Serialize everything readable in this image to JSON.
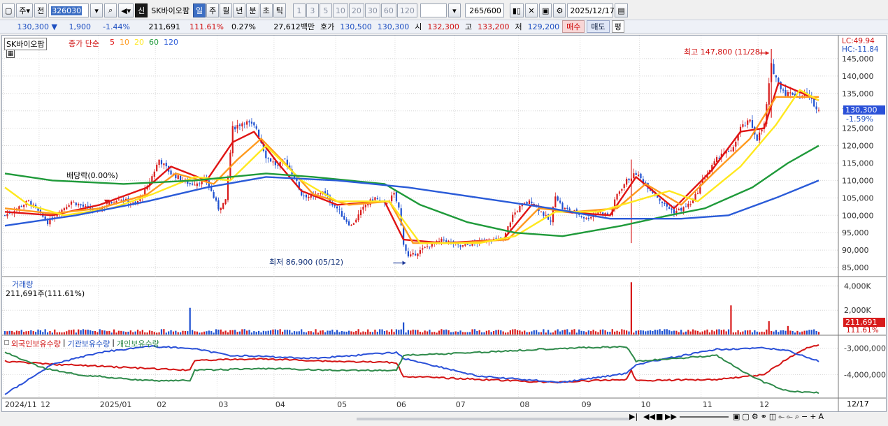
{
  "toolbar": {
    "period_label": "주",
    "prev_label": "전",
    "code": "326030",
    "shin_label": "신",
    "stock_name": "SK바이오팜",
    "period_buttons": [
      "일",
      "주",
      "월",
      "년",
      "분",
      "초",
      "틱"
    ],
    "period_selected": "일",
    "intervals": [
      "1",
      "3",
      "5",
      "10",
      "20",
      "30",
      "60",
      "120"
    ],
    "count_value": "265",
    "count_total": "/600",
    "date_value": "2025/12/17"
  },
  "quote": {
    "price": "130,300",
    "change": "1,900",
    "change_pct": "-1.44%",
    "volume": "211,691",
    "volume_ratio": "111.61%",
    "turnover_rate": "0.27%",
    "amount": "27,612백만",
    "bid_label": "호가",
    "bid": "130,500",
    "ask": "130,300",
    "open_label": "시",
    "open": "132,300",
    "high_label": "고",
    "high": "133,200",
    "low_label": "저",
    "low": "129,200",
    "buy_label": "매수",
    "sell_label": "매도",
    "avg_label": "평"
  },
  "price_panel": {
    "stock_label": "SK바이오팜",
    "legend_prefix": "종가 단순",
    "ma_periods": [
      "5",
      "10",
      "20",
      "60",
      "120"
    ],
    "ma_colors": [
      "#e01414",
      "#ff9a1e",
      "#ffe81e",
      "#1f9a3a",
      "#2a5bd8"
    ],
    "lc_label": "LC:49.94",
    "hc_label": "HC:-11.84",
    "current_price_tag": "130,300",
    "current_pct_tag": "-1.59%",
    "high_annotation": "최고 147,800 (11/28)",
    "low_annotation": "최저 86,900 (05/12)",
    "dividend_annotation": "배당락(0.00%)"
  },
  "volume_panel": {
    "title": "거래량",
    "value_label": "211,691주(111.61%)",
    "current_tag": "211,691",
    "current_pct": "111.61%"
  },
  "holdings_panel": {
    "foreign_label": "외국인보유수량",
    "institution_label": "기관보유수량",
    "individual_label": "개인보유수량",
    "sep1": "|",
    "sep2": "|"
  },
  "x_axis": {
    "labels": [
      "2024/11",
      "12",
      "2025/01",
      "02",
      "03",
      "04",
      "05",
      "06",
      "07",
      "08",
      "09",
      "10",
      "11",
      "12"
    ],
    "right_label": "12/17"
  },
  "chart_data": [
    {
      "type": "candlestick",
      "title": "SK바이오팜",
      "ylim": [
        83000,
        150000
      ],
      "y_ticks": [
        85000,
        90000,
        95000,
        100000,
        105000,
        110000,
        115000,
        120000,
        125000,
        130000,
        135000,
        140000,
        145000
      ],
      "y_tick_labels": [
        "85,000",
        "90,000",
        "95,000",
        "100,000",
        "105,000",
        "110,000",
        "115,000",
        "120,000",
        "125,000",
        "130,000",
        "135,000",
        "140,000",
        "145,000"
      ],
      "up_color": "#d81b1b",
      "down_color": "#1e50d0",
      "close_path": [
        [
          0,
          100000
        ],
        [
          10,
          104000
        ],
        [
          18,
          98000
        ],
        [
          28,
          104000
        ],
        [
          38,
          101000
        ],
        [
          48,
          105000
        ],
        [
          55,
          103000
        ],
        [
          60,
          108000
        ],
        [
          65,
          116000
        ],
        [
          70,
          112000
        ],
        [
          78,
          109000
        ],
        [
          85,
          110000
        ],
        [
          90,
          102000
        ],
        [
          93,
          104000
        ],
        [
          96,
          125000
        ],
        [
          101,
          127000
        ],
        [
          106,
          125000
        ],
        [
          110,
          117000
        ],
        [
          115,
          114000
        ],
        [
          118,
          116000
        ],
        [
          122,
          111000
        ],
        [
          125,
          106000
        ],
        [
          130,
          105000
        ],
        [
          134,
          107000
        ],
        [
          137,
          104000
        ],
        [
          140,
          102000
        ],
        [
          143,
          99000
        ],
        [
          146,
          97000
        ],
        [
          149,
          100000
        ],
        [
          152,
          103000
        ],
        [
          156,
          105000
        ],
        [
          160,
          103000
        ],
        [
          164,
          106000
        ],
        [
          166,
          102000
        ],
        [
          168,
          92000
        ],
        [
          170,
          88000
        ],
        [
          173,
          89000
        ],
        [
          178,
          91000
        ],
        [
          185,
          93000
        ],
        [
          192,
          91000
        ],
        [
          198,
          92000
        ],
        [
          204,
          93000
        ],
        [
          210,
          93000
        ],
        [
          214,
          100000
        ],
        [
          218,
          103000
        ],
        [
          222,
          104000
        ],
        [
          226,
          101000
        ],
        [
          230,
          98000
        ],
        [
          232,
          106000
        ],
        [
          235,
          102000
        ],
        [
          240,
          101000
        ],
        [
          245,
          99000
        ],
        [
          250,
          101000
        ],
        [
          255,
          100000
        ],
        [
          258,
          106000
        ],
        [
          262,
          110000
        ],
        [
          266,
          112000
        ],
        [
          270,
          109000
        ],
        [
          274,
          106000
        ],
        [
          278,
          103000
        ],
        [
          282,
          101000
        ],
        [
          286,
          102000
        ],
        [
          290,
          104000
        ],
        [
          294,
          110000
        ],
        [
          298,
          114000
        ],
        [
          302,
          118000
        ],
        [
          306,
          118000
        ],
        [
          310,
          125000
        ],
        [
          314,
          127000
        ],
        [
          317,
          122000
        ],
        [
          320,
          126000
        ],
        [
          323,
          143000
        ],
        [
          326,
          138000
        ],
        [
          329,
          135000
        ],
        [
          332,
          135000
        ],
        [
          335,
          134000
        ],
        [
          338,
          135000
        ],
        [
          341,
          132000
        ],
        [
          343,
          130300
        ]
      ],
      "ma": [
        {
          "period": 5,
          "points": [
            [
              0,
              101000
            ],
            [
              20,
              100000
            ],
            [
              40,
              103000
            ],
            [
              60,
              108000
            ],
            [
              70,
              114000
            ],
            [
              85,
              110000
            ],
            [
              96,
              121000
            ],
            [
              105,
              124000
            ],
            [
              115,
              115000
            ],
            [
              125,
              107000
            ],
            [
              140,
              103000
            ],
            [
              160,
              104000
            ],
            [
              168,
              93000
            ],
            [
              185,
              92000
            ],
            [
              210,
              93000
            ],
            [
              222,
              103000
            ],
            [
              235,
              101000
            ],
            [
              255,
              100000
            ],
            [
              266,
              111000
            ],
            [
              282,
              102000
            ],
            [
              298,
              113000
            ],
            [
              310,
              124000
            ],
            [
              320,
              125000
            ],
            [
              326,
              138000
            ],
            [
              343,
              133000
            ]
          ]
        },
        {
          "period": 10,
          "points": [
            [
              0,
              102000
            ],
            [
              20,
              100500
            ],
            [
              40,
              102000
            ],
            [
              60,
              106000
            ],
            [
              72,
              112000
            ],
            [
              88,
              109000
            ],
            [
              98,
              116000
            ],
            [
              108,
              122000
            ],
            [
              118,
              115000
            ],
            [
              130,
              106000
            ],
            [
              145,
              103000
            ],
            [
              162,
              104000
            ],
            [
              172,
              92000
            ],
            [
              190,
              92000
            ],
            [
              212,
              93000
            ],
            [
              225,
              102000
            ],
            [
              240,
              101000
            ],
            [
              258,
              102000
            ],
            [
              270,
              109000
            ],
            [
              285,
              103000
            ],
            [
              300,
              113000
            ],
            [
              314,
              122000
            ],
            [
              325,
              134000
            ],
            [
              343,
              134000
            ]
          ]
        },
        {
          "period": 20,
          "points": [
            [
              0,
              108000
            ],
            [
              10,
              103000
            ],
            [
              25,
              100000
            ],
            [
              45,
              102000
            ],
            [
              62,
              106000
            ],
            [
              80,
              111000
            ],
            [
              95,
              110000
            ],
            [
              110,
              120000
            ],
            [
              125,
              110000
            ],
            [
              140,
              104000
            ],
            [
              162,
              104000
            ],
            [
              175,
              92000
            ],
            [
              200,
              92000
            ],
            [
              215,
              94000
            ],
            [
              232,
              101000
            ],
            [
              250,
              101000
            ],
            [
              265,
              104000
            ],
            [
              280,
              107000
            ],
            [
              292,
              104000
            ],
            [
              310,
              114000
            ],
            [
              325,
              126000
            ],
            [
              335,
              136000
            ],
            [
              343,
              133000
            ]
          ]
        },
        {
          "period": 60,
          "points": [
            [
              0,
              112000
            ],
            [
              20,
              110000
            ],
            [
              50,
              109000
            ],
            [
              80,
              110000
            ],
            [
              110,
              112000
            ],
            [
              130,
              111000
            ],
            [
              160,
              109000
            ],
            [
              175,
              103000
            ],
            [
              195,
              98000
            ],
            [
              215,
              95000
            ],
            [
              235,
              94000
            ],
            [
              260,
              97000
            ],
            [
              280,
              100000
            ],
            [
              295,
              102000
            ],
            [
              315,
              108000
            ],
            [
              330,
              115000
            ],
            [
              343,
              120000
            ]
          ]
        },
        {
          "period": 120,
          "points": [
            [
              0,
              97000
            ],
            [
              30,
              100000
            ],
            [
              60,
              104000
            ],
            [
              85,
              108000
            ],
            [
              110,
              111000
            ],
            [
              140,
              110000
            ],
            [
              170,
              108000
            ],
            [
              200,
              105000
            ],
            [
              230,
              102000
            ],
            [
              255,
              99000
            ],
            [
              285,
              99000
            ],
            [
              305,
              100000
            ],
            [
              325,
              105000
            ],
            [
              343,
              110000
            ]
          ]
        }
      ],
      "annotations": [
        {
          "label": "최고 147,800 (11/28)",
          "x_index": 323,
          "y": 147800
        },
        {
          "label": "최저 86,900 (05/12)",
          "x_index": 170,
          "y": 86900
        },
        {
          "label": "배당락(0.00%)",
          "x_index": 43,
          "y": 110000
        }
      ]
    },
    {
      "type": "bar",
      "title": "거래량",
      "ylim": [
        0,
        4600000
      ],
      "y_ticks": [
        2000000,
        4000000
      ],
      "y_tick_labels": [
        "2,000K",
        "4,000K"
      ],
      "spikes": [
        [
          78,
          2200000
        ],
        [
          168,
          1000000
        ],
        [
          264,
          4300000
        ],
        [
          306,
          2400000
        ],
        [
          322,
          1100000
        ],
        [
          330,
          700000
        ]
      ],
      "base_level": 300000,
      "last_value": 211691
    },
    {
      "type": "line",
      "title": "외국인보유수량 | 기관보유수량 | 개인보유수량",
      "ylim": [
        -4800000,
        -2500000
      ],
      "y_ticks": [
        -3000000,
        -4000000
      ],
      "y_tick_labels": [
        "-3,000,000",
        "-4,000,000"
      ],
      "series": [
        {
          "name": "외국인보유수량",
          "color": "#d41414",
          "points": [
            [
              0,
              0.4
            ],
            [
              20,
              0.45
            ],
            [
              40,
              0.48
            ],
            [
              60,
              0.52
            ],
            [
              78,
              0.55
            ],
            [
              80,
              0.38
            ],
            [
              110,
              0.36
            ],
            [
              140,
              0.4
            ],
            [
              165,
              0.42
            ],
            [
              168,
              0.65
            ],
            [
              200,
              0.7
            ],
            [
              230,
              0.75
            ],
            [
              262,
              0.7
            ],
            [
              264,
              0.55
            ],
            [
              266,
              0.72
            ],
            [
              300,
              0.7
            ],
            [
              320,
              0.62
            ],
            [
              330,
              0.35
            ],
            [
              338,
              0.18
            ],
            [
              343,
              0.12
            ]
          ]
        },
        {
          "name": "기관보유수량",
          "color": "#2a50d8",
          "points": [
            [
              0,
              0.95
            ],
            [
              10,
              0.7
            ],
            [
              20,
              0.45
            ],
            [
              40,
              0.25
            ],
            [
              60,
              0.15
            ],
            [
              78,
              0.18
            ],
            [
              95,
              0.3
            ],
            [
              130,
              0.35
            ],
            [
              165,
              0.25
            ],
            [
              168,
              0.35
            ],
            [
              200,
              0.65
            ],
            [
              235,
              0.75
            ],
            [
              262,
              0.6
            ],
            [
              266,
              0.45
            ],
            [
              300,
              0.2
            ],
            [
              320,
              0.18
            ],
            [
              330,
              0.22
            ],
            [
              343,
              0.4
            ]
          ]
        },
        {
          "name": "개인보유수량",
          "color": "#2e8a4a",
          "points": [
            [
              0,
              0.25
            ],
            [
              15,
              0.5
            ],
            [
              30,
              0.62
            ],
            [
              60,
              0.72
            ],
            [
              78,
              0.72
            ],
            [
              80,
              0.55
            ],
            [
              110,
              0.52
            ],
            [
              140,
              0.55
            ],
            [
              165,
              0.55
            ],
            [
              168,
              0.3
            ],
            [
              200,
              0.25
            ],
            [
              235,
              0.18
            ],
            [
              262,
              0.16
            ],
            [
              266,
              0.4
            ],
            [
              300,
              0.3
            ],
            [
              310,
              0.55
            ],
            [
              320,
              0.75
            ],
            [
              330,
              0.9
            ],
            [
              343,
              0.92
            ]
          ]
        }
      ]
    }
  ],
  "colors": {
    "up": "#d81b1b",
    "down": "#1e50d0",
    "accent_blue": "#3d6fc4",
    "price_tag_bg": "#2a50d8",
    "volume_tag_bg": "#d81b1b"
  }
}
